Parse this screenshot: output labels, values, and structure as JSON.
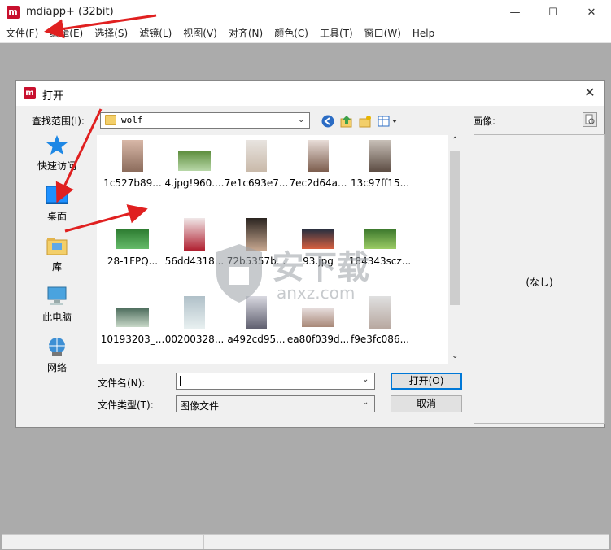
{
  "window": {
    "logo_text": "m",
    "title": "mdiapp+ (32bit)",
    "minimize": "—",
    "maximize": "☐",
    "close": "✕"
  },
  "menubar": [
    "文件(F)",
    "编辑(E)",
    "选择(S)",
    "滤镜(L)",
    "视图(V)",
    "对齐(N)",
    "颜色(C)",
    "工具(T)",
    "窗口(W)",
    "Help"
  ],
  "dialog": {
    "logo_text": "m",
    "title": "打开",
    "close": "✕",
    "look_in_label": "查找范围(I):",
    "look_in_value": "wolf",
    "preview_label": "画像:",
    "preview_text": "(なし)",
    "places": [
      {
        "label": "快速访问",
        "icon": "star-icon"
      },
      {
        "label": "桌面",
        "icon": "desktop-icon"
      },
      {
        "label": "库",
        "icon": "library-icon"
      },
      {
        "label": "此电脑",
        "icon": "computer-icon"
      },
      {
        "label": "网络",
        "icon": "network-icon"
      }
    ],
    "files": [
      "1c527b89...",
      "4.jpg!960....",
      "7e1c693e7...",
      "7ec2d64a...",
      "13c97ff15...",
      "28-1FPQ...",
      "56dd4318...",
      "72b5357b...",
      "93.jpg",
      "184343scz...",
      "10193203_...",
      "00200328...",
      "a492cd95...",
      "ea80f039d...",
      "f9e3fc086..."
    ],
    "filename_label": "文件名(N):",
    "filename_value": "",
    "filetype_label": "文件类型(T):",
    "filetype_value": "图像文件",
    "open_button": "打开(O)",
    "cancel_button": "取消"
  },
  "watermark": {
    "cn": "安下载",
    "en": "anxz.com"
  },
  "colors": {
    "brand": "#c8102e",
    "arrow": "#e02020",
    "background": "#ababab"
  }
}
